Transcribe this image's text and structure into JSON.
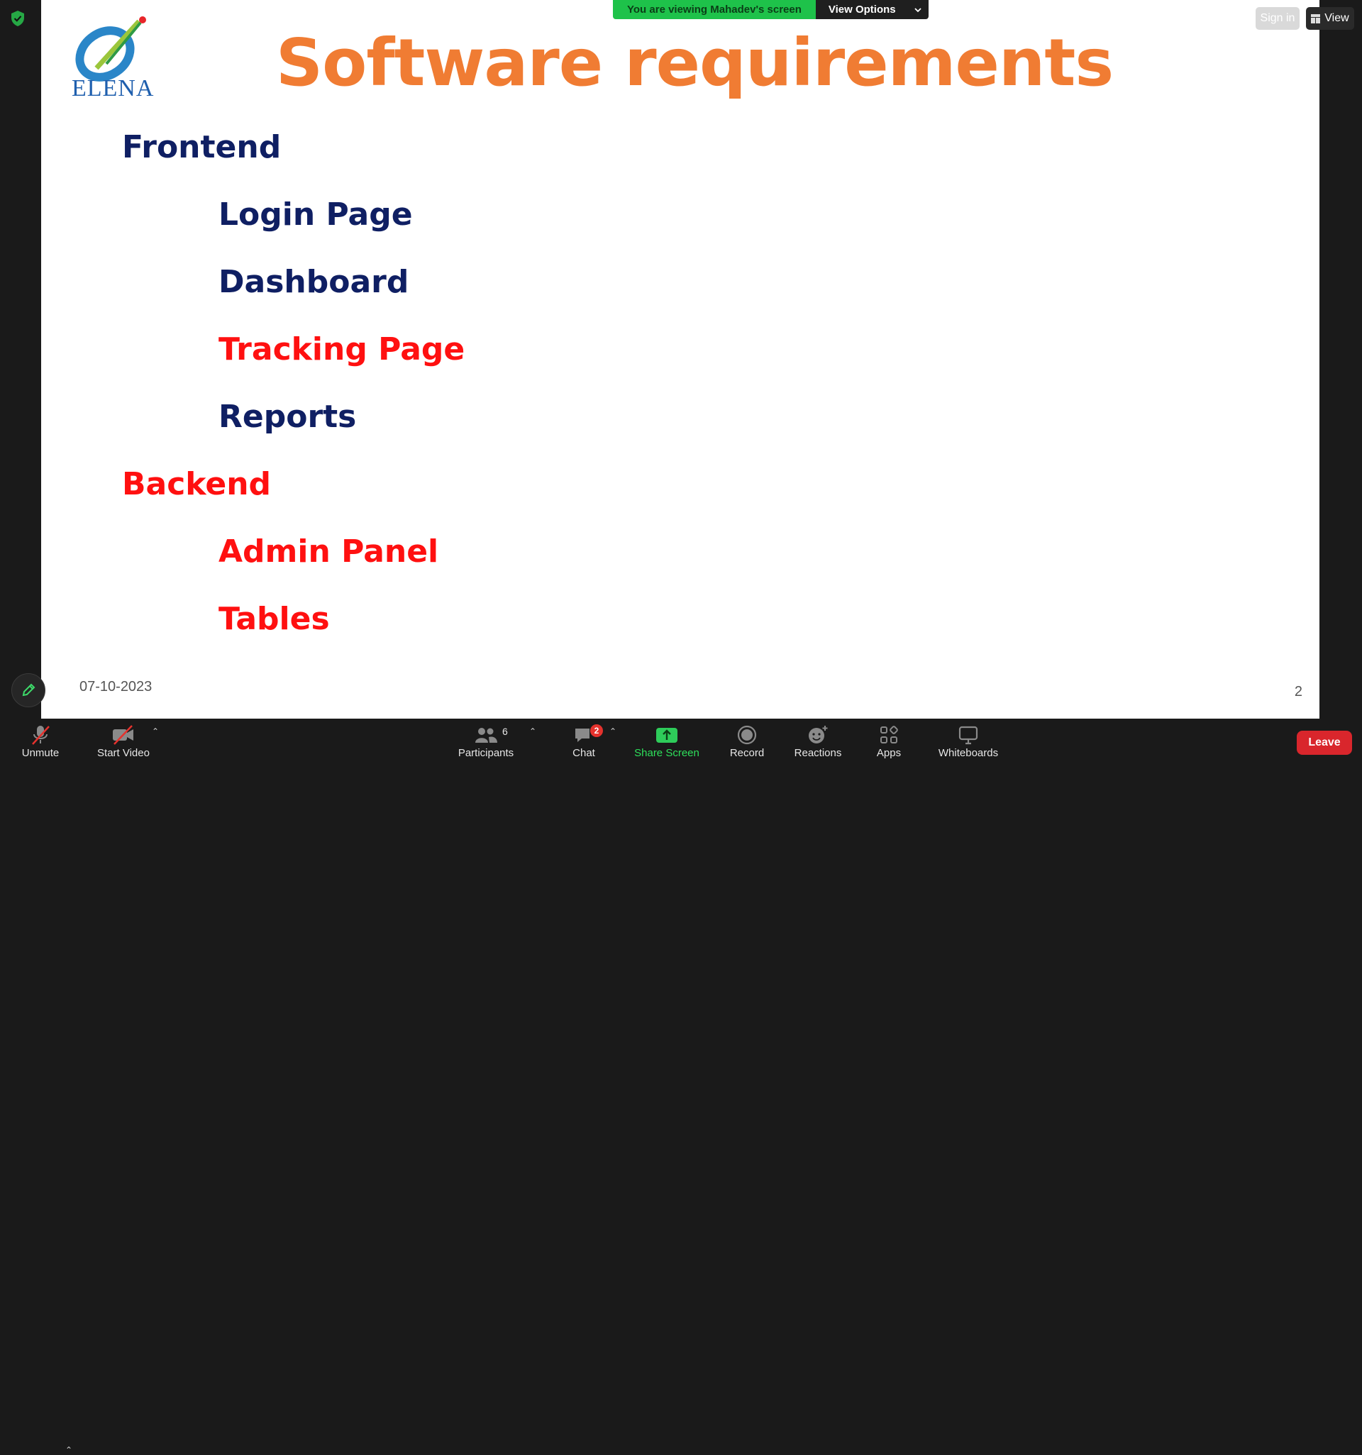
{
  "banner": {
    "viewing_text": "You are viewing Mahadev's screen",
    "view_options_label": "View Options"
  },
  "top_right": {
    "sign_in_label": "Sign in",
    "view_label": "View"
  },
  "slide": {
    "logo_text": "ELENA",
    "title": "Software requirements",
    "items": [
      {
        "text": "Frontend",
        "level": 1,
        "color": "#0f1f63"
      },
      {
        "text": "Login Page",
        "level": 2,
        "color": "#0f1f63"
      },
      {
        "text": "Dashboard",
        "level": 2,
        "color": "#0f1f63"
      },
      {
        "text": "Tracking Page",
        "level": 2,
        "color": "#ff1010"
      },
      {
        "text": "Reports",
        "level": 2,
        "color": "#0f1f63"
      },
      {
        "text": "Backend",
        "level": 1,
        "color": "#ff1010"
      },
      {
        "text": "Admin Panel",
        "level": 2,
        "color": "#ff1010"
      },
      {
        "text": "Tables",
        "level": 2,
        "color": "#ff1010"
      }
    ],
    "date": "07-10-2023",
    "page_number": "2"
  },
  "toolbar": {
    "unmute_label": "Unmute",
    "start_video_label": "Start Video",
    "participants_label": "Participants",
    "participants_count": "6",
    "chat_label": "Chat",
    "chat_badge": "2",
    "share_screen_label": "Share Screen",
    "record_label": "Record",
    "reactions_label": "Reactions",
    "apps_label": "Apps",
    "whiteboards_label": "Whiteboards",
    "leave_label": "Leave"
  },
  "colors": {
    "title_orange": "#f07c33",
    "navy": "#0f1f63",
    "red": "#ff1010",
    "share_green": "#2ee05b",
    "leave_red": "#d9262c"
  }
}
